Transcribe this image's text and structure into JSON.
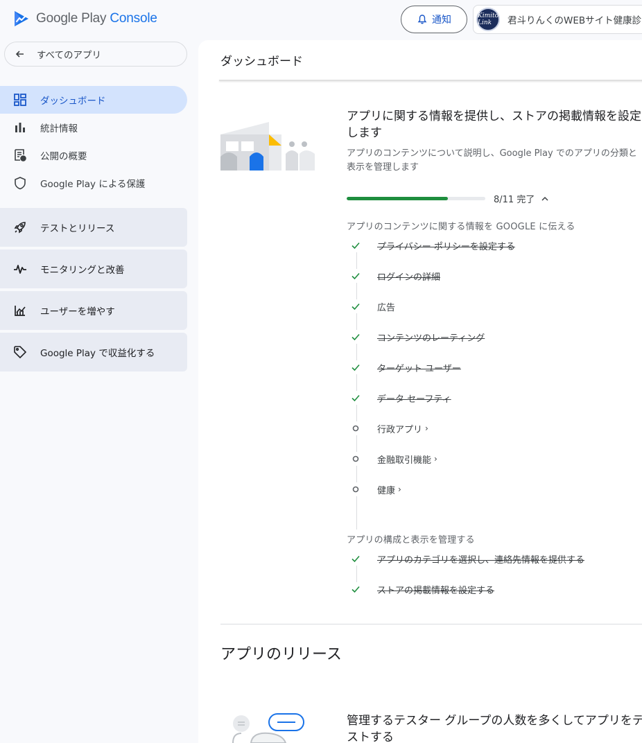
{
  "header": {
    "logo_text_main": "Google Play",
    "logo_text_console": "Console",
    "notify_label": "通知",
    "account_name": "君斗りんくのWEBサイト健康診断",
    "avatar_text": "Kimito Link"
  },
  "sidebar": {
    "back_label": "すべてのアプリ",
    "items": [
      {
        "label": "ダッシュボード",
        "icon": "dashboard-icon",
        "active": true
      },
      {
        "label": "統計情報",
        "icon": "bar-chart-icon"
      },
      {
        "label": "公開の概要",
        "icon": "publishing-overview-icon"
      },
      {
        "label": "Google Play による保護",
        "icon": "shield-icon"
      }
    ],
    "groups": [
      {
        "label": "テストとリリース",
        "icon": "rocket-icon"
      },
      {
        "label": "モニタリングと改善",
        "icon": "pulse-icon"
      },
      {
        "label": "ユーザーを増やす",
        "icon": "growth-icon"
      },
      {
        "label": "Google Play で収益化する",
        "icon": "tag-icon"
      }
    ]
  },
  "main": {
    "page_title": "ダッシュボード",
    "setup_card": {
      "title": "アプリに関する情報を提供し、ストアの掲載情報を設定します",
      "description": "アプリのコンテンツについて説明し、Google Play でのアプリの分類と表示を管理します",
      "progress_fraction": 0.73,
      "progress_label": "8/11 完了",
      "section1_label": "アプリのコンテンツに関する情報を GOOGLE に伝える",
      "section1_tasks": [
        {
          "label": "プライバシー ポリシーを設定する",
          "done": true
        },
        {
          "label": "ログインの詳細",
          "done": true
        },
        {
          "label": "広告",
          "done": false,
          "check": true
        },
        {
          "label": "コンテンツのレーティング",
          "done": true
        },
        {
          "label": "ターゲット ユーザー",
          "done": true
        },
        {
          "label": "データ セーフティ",
          "done": true
        },
        {
          "label": "行政アプリ",
          "done": false
        },
        {
          "label": "金融取引機能",
          "done": false
        },
        {
          "label": "健康",
          "done": false
        }
      ],
      "section2_label": "アプリの構成と表示を管理する",
      "section2_tasks": [
        {
          "label": "アプリのカテゴリを選択し、連絡先情報を提供する",
          "done": true
        },
        {
          "label": "ストアの掲載情報を設定する",
          "done": true
        }
      ],
      "chevron": "›"
    },
    "release_section": {
      "title": "アプリのリリース",
      "card_title": "管理するテスター グループの人数を多くしてアプリをテストする"
    }
  },
  "colors": {
    "accent_blue": "#1a73e8",
    "active_nav_bg": "#d3e3fd",
    "progress_green": "#1e8e3e"
  }
}
